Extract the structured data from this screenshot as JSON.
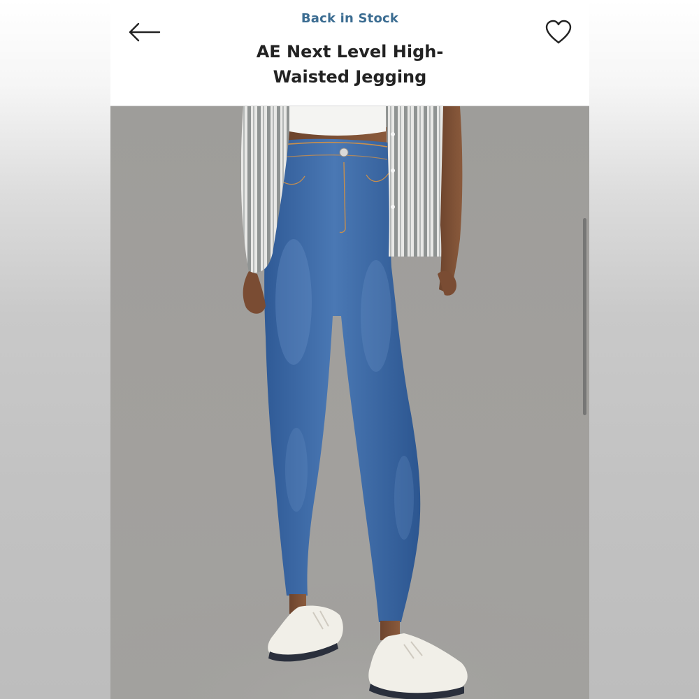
{
  "header": {
    "status_label": "Back in Stock",
    "product_title": "AE Next Level High-Waisted Jegging",
    "back_icon": "arrow-left-icon",
    "favorite_icon": "heart-outline-icon"
  },
  "colors": {
    "status_text": "#3c6d92",
    "title_text": "#222222",
    "photo_background": "#a09f9c",
    "denim": "#3e6aa6"
  },
  "product_image": {
    "subject": "model wearing medium-wash blue high-waisted skinny jeans, white crop top, striped shirt and white canvas sneakers"
  }
}
